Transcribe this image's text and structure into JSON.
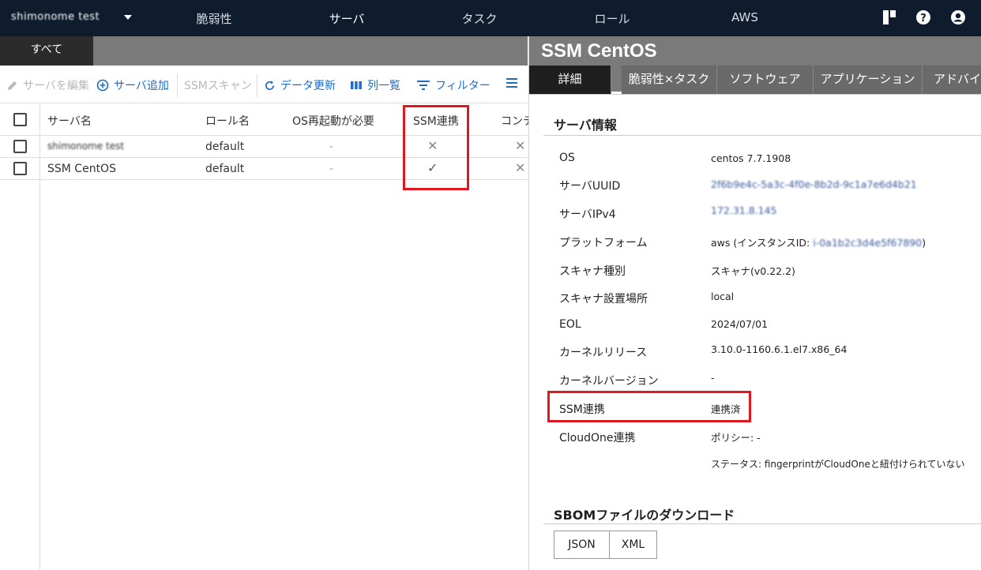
{
  "topnav": {
    "org_name": "shimonome test",
    "items": [
      "脆弱性",
      "サーバ",
      "タスク",
      "ロール",
      "AWS"
    ],
    "active": "サーバ"
  },
  "left": {
    "tab_all": "すべて",
    "toolbar": {
      "edit": "サーバを編集",
      "add": "サーバ追加",
      "scan": "SSMスキャン",
      "refresh": "データ更新",
      "columns": "列一覧",
      "filter": "フィルター"
    },
    "table": {
      "headers": [
        "サーバ名",
        "ロール名",
        "OS再起動が必要",
        "SSM連携",
        "コンテ"
      ],
      "rows": [
        {
          "name": "shimonome test",
          "role": "default",
          "reboot": "-",
          "ssm": "✕",
          "container": "✕"
        },
        {
          "name": "SSM CentOS",
          "role": "default",
          "reboot": "-",
          "ssm": "✓",
          "container": "✕"
        }
      ]
    }
  },
  "right": {
    "title": "SSM CentOS",
    "tabs": [
      "詳細",
      "脆弱性×タスク",
      "ソフトウェア",
      "アプリケーション",
      "アドバイ"
    ],
    "server_info_title": "サーバ情報",
    "info": [
      {
        "label": "OS",
        "value": "centos 7.7.1908"
      },
      {
        "label": "サーバUUID",
        "value": "2f6b9e4c-5a3c-4f0e-8b2d-9c1a7e6d4b21"
      },
      {
        "label": "サーバIPv4",
        "value": "172.31.8.145"
      },
      {
        "label": "プラットフォーム",
        "value_prefix": "aws (インスタンスID: ",
        "value_masked": "i-0a1b2c3d4e5f67890",
        "value_suffix": ")"
      },
      {
        "label": "スキャナ種別",
        "value": "スキャナ(v0.22.2)"
      },
      {
        "label": "スキャナ設置場所",
        "value": "local"
      },
      {
        "label": "EOL",
        "value": "2024/07/01"
      },
      {
        "label": "カーネルリリース",
        "value": "3.10.0-1160.6.1.el7.x86_64"
      },
      {
        "label": "カーネルバージョン",
        "value": "-"
      },
      {
        "label": "SSM連携",
        "value": "連携済"
      },
      {
        "label": "CloudOne連携",
        "value": "ポリシー: -",
        "value2": "ステータス: fingerprintがCloudOneと紐付けられていない"
      }
    ],
    "sbom_title": "SBOMファイルのダウンロード",
    "sbom_buttons": [
      "JSON",
      "XML"
    ]
  },
  "colors": {
    "topbar": "#0e1c2e",
    "accent": "#1e6bc6",
    "highlight": "#e0171e"
  }
}
